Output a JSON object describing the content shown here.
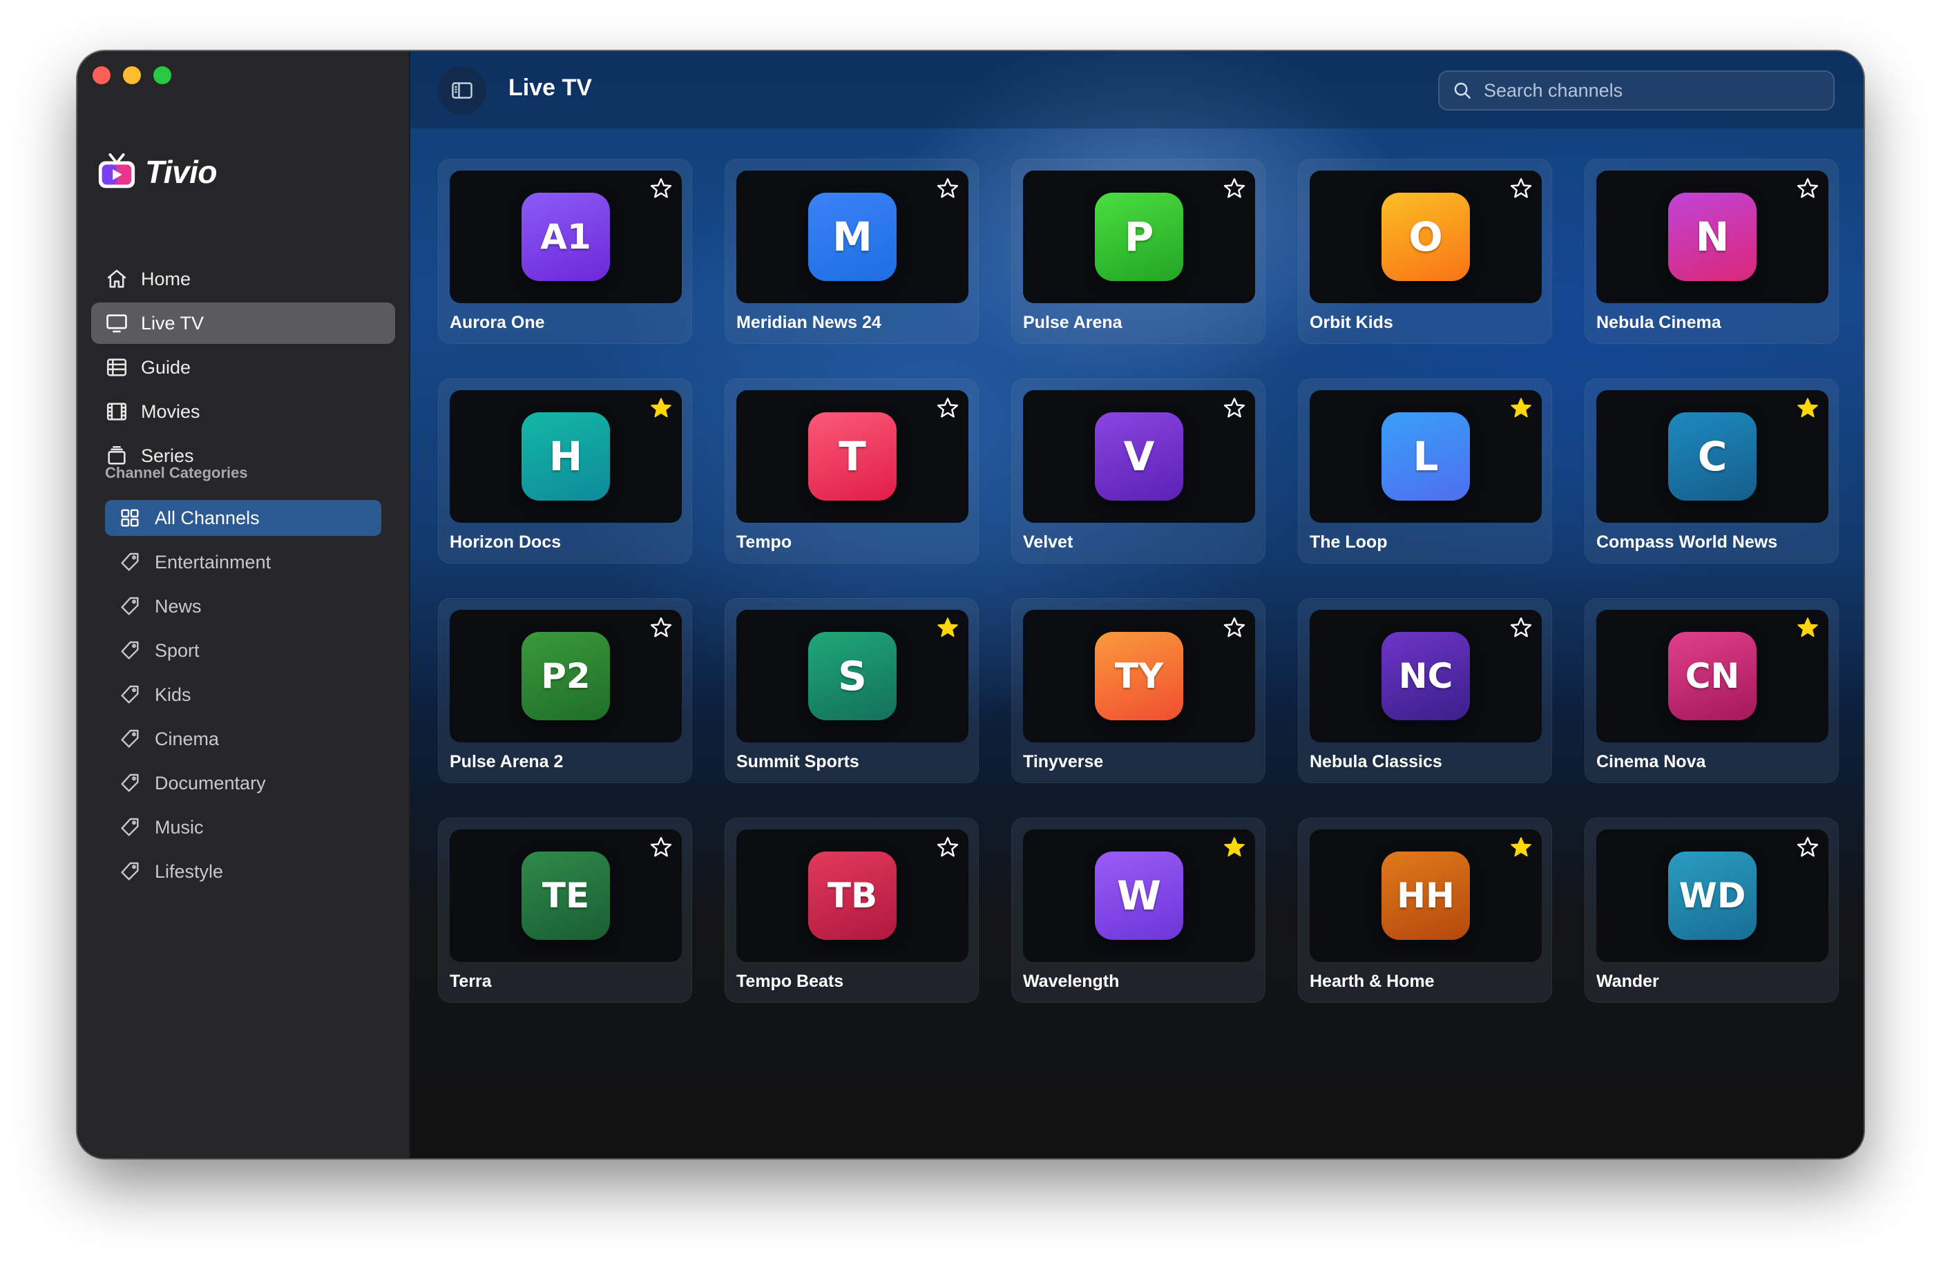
{
  "app": {
    "name": "Tivio"
  },
  "nav": [
    {
      "label": "Home",
      "icon": "home-icon",
      "active": false
    },
    {
      "label": "Live TV",
      "icon": "tv-icon",
      "active": true
    },
    {
      "label": "Guide",
      "icon": "guide-icon",
      "active": false
    },
    {
      "label": "Movies",
      "icon": "film-icon",
      "active": false
    },
    {
      "label": "Series",
      "icon": "series-icon",
      "active": false
    }
  ],
  "categories": {
    "heading": "Channel Categories",
    "items": [
      {
        "label": "All Channels",
        "icon": "grid-icon",
        "active": true
      },
      {
        "label": "Entertainment",
        "icon": "tag-icon",
        "active": false
      },
      {
        "label": "News",
        "icon": "tag-icon",
        "active": false
      },
      {
        "label": "Sport",
        "icon": "tag-icon",
        "active": false
      },
      {
        "label": "Kids",
        "icon": "tag-icon",
        "active": false
      },
      {
        "label": "Cinema",
        "icon": "tag-icon",
        "active": false
      },
      {
        "label": "Documentary",
        "icon": "tag-icon",
        "active": false
      },
      {
        "label": "Music",
        "icon": "tag-icon",
        "active": false
      },
      {
        "label": "Lifestyle",
        "icon": "tag-icon",
        "active": false
      }
    ]
  },
  "header": {
    "title": "Live TV",
    "search_placeholder": "Search channels"
  },
  "colors": {
    "accent": "#2b5a93",
    "favorite_star": "#ffd60a"
  },
  "channels": [
    {
      "name": "Aurora One",
      "abbr": "A1",
      "favorite": false,
      "colors": [
        "#8b5cf6",
        "#6d28d9"
      ]
    },
    {
      "name": "Meridian News 24",
      "abbr": "M",
      "favorite": false,
      "colors": [
        "#3b82f6",
        "#1d6fe0"
      ]
    },
    {
      "name": "Pulse Arena",
      "abbr": "P",
      "favorite": false,
      "colors": [
        "#4ade40",
        "#22a524"
      ]
    },
    {
      "name": "Orbit Kids",
      "abbr": "O",
      "favorite": false,
      "colors": [
        "#fbbf24",
        "#f97316"
      ]
    },
    {
      "name": "Nebula Cinema",
      "abbr": "N",
      "favorite": false,
      "colors": [
        "#c044d8",
        "#db2777"
      ]
    },
    {
      "name": "Horizon Docs",
      "abbr": "H",
      "favorite": true,
      "colors": [
        "#14b8a6",
        "#0e8a9a"
      ]
    },
    {
      "name": "Tempo",
      "abbr": "T",
      "favorite": false,
      "colors": [
        "#fb5a78",
        "#e11d48"
      ]
    },
    {
      "name": "Velvet",
      "abbr": "V",
      "favorite": false,
      "colors": [
        "#8b45e0",
        "#5b21b6"
      ]
    },
    {
      "name": "The Loop",
      "abbr": "L",
      "favorite": true,
      "colors": [
        "#38a0f8",
        "#4f6ef0"
      ]
    },
    {
      "name": "Compass World News",
      "abbr": "C",
      "favorite": true,
      "colors": [
        "#1d8ac0",
        "#155e8a"
      ]
    },
    {
      "name": "Pulse Arena 2",
      "abbr": "P2",
      "favorite": false,
      "colors": [
        "#3a9a3a",
        "#1f6e2a"
      ]
    },
    {
      "name": "Summit Sports",
      "abbr": "S",
      "favorite": true,
      "colors": [
        "#1fa878",
        "#13705a"
      ]
    },
    {
      "name": "Tinyverse",
      "abbr": "TY",
      "favorite": false,
      "colors": [
        "#fb9a3c",
        "#f04e30"
      ]
    },
    {
      "name": "Nebula Classics",
      "abbr": "NC",
      "favorite": false,
      "colors": [
        "#6d35c8",
        "#3b1f8a"
      ]
    },
    {
      "name": "Cinema Nova",
      "abbr": "CN",
      "favorite": true,
      "colors": [
        "#e0408a",
        "#a4185a"
      ]
    },
    {
      "name": "Terra",
      "abbr": "TE",
      "favorite": false,
      "colors": [
        "#2f8a4a",
        "#1a5e34"
      ]
    },
    {
      "name": "Tempo Beats",
      "abbr": "TB",
      "favorite": false,
      "colors": [
        "#e23a5a",
        "#b01840"
      ]
    },
    {
      "name": "Wavelength",
      "abbr": "W",
      "favorite": true,
      "colors": [
        "#9a5cf6",
        "#6d35d8"
      ]
    },
    {
      "name": "Hearth & Home",
      "abbr": "HH",
      "favorite": true,
      "colors": [
        "#e07a1a",
        "#b4480e"
      ]
    },
    {
      "name": "Wander",
      "abbr": "WD",
      "favorite": false,
      "colors": [
        "#2a9cc0",
        "#186e94"
      ]
    }
  ]
}
